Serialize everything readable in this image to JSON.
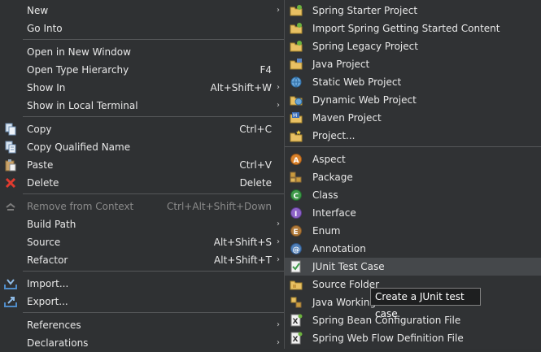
{
  "main_menu": {
    "new": {
      "label": "New"
    },
    "go_into": {
      "label": "Go Into"
    },
    "open_new_window": {
      "label": "Open in New Window"
    },
    "open_type_hierarchy": {
      "label": "Open Type Hierarchy",
      "accel": "F4"
    },
    "show_in": {
      "label": "Show In",
      "accel": "Alt+Shift+W"
    },
    "show_local_terminal": {
      "label": "Show in Local Terminal"
    },
    "copy": {
      "label": "Copy",
      "accel": "Ctrl+C"
    },
    "copy_qualified": {
      "label": "Copy Qualified Name"
    },
    "paste": {
      "label": "Paste",
      "accel": "Ctrl+V"
    },
    "delete": {
      "label": "Delete",
      "accel": "Delete"
    },
    "remove_context": {
      "label": "Remove from Context",
      "accel": "Ctrl+Alt+Shift+Down"
    },
    "build_path": {
      "label": "Build Path"
    },
    "source": {
      "label": "Source",
      "accel": "Alt+Shift+S"
    },
    "refactor": {
      "label": "Refactor",
      "accel": "Alt+Shift+T"
    },
    "import": {
      "label": "Import..."
    },
    "export": {
      "label": "Export..."
    },
    "references": {
      "label": "References"
    },
    "declarations": {
      "label": "Declarations"
    }
  },
  "sub_menu": {
    "spring_starter": "Spring Starter Project",
    "import_spring": "Import Spring Getting Started Content",
    "spring_legacy": "Spring Legacy Project",
    "java_project": "Java Project",
    "static_web": "Static Web Project",
    "dynamic_web": "Dynamic Web Project",
    "maven_project": "Maven Project",
    "project": "Project...",
    "aspect": "Aspect",
    "package": "Package",
    "class": "Class",
    "interface": "Interface",
    "enum": "Enum",
    "annotation": "Annotation",
    "junit": "JUnit Test Case",
    "source_folder": "Source Folder",
    "java_working_set": "Java Working Set",
    "spring_bean": "Spring Bean Configuration File",
    "spring_webflow": "Spring Web Flow Definition File"
  },
  "tooltip": {
    "text": "Create a JUnit test case"
  },
  "arrow_glyph": "›"
}
